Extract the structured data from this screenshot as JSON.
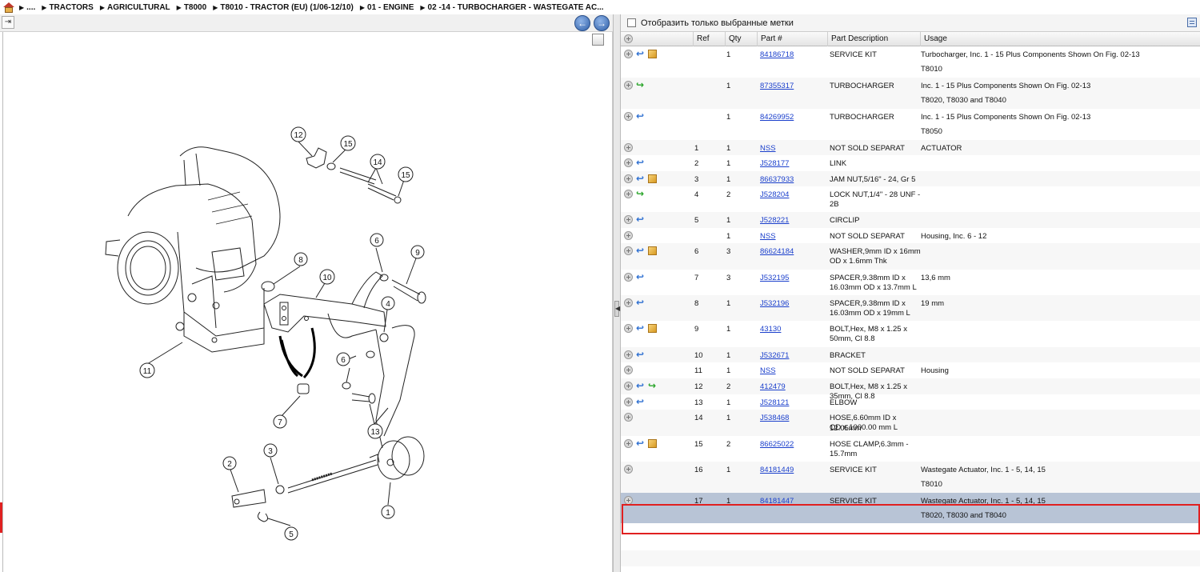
{
  "breadcrumb": {
    "items": [
      "....",
      "TRACTORS",
      "AGRICULTURAL",
      "T8000",
      "T8010 - TRACTOR (EU) (1/06-12/10)",
      "01 - ENGINE",
      "02 -14 - TURBOCHARGER - WASTEGATE AC..."
    ]
  },
  "filter": {
    "label": "Отобразить только выбранные метки"
  },
  "table": {
    "headers": {
      "ref": "Ref",
      "qty": "Qty",
      "part": "Part #",
      "desc": "Part Description",
      "usage": "Usage"
    },
    "rows": [
      {
        "ref": "",
        "qty": "1",
        "part": "84186718",
        "desc": "SERVICE KIT",
        "usage": "Turbocharger, Inc. 1 - 15 Plus Components Shown On Fig. 02-13",
        "usage2": "T8010",
        "icons": [
          "plus",
          "blue",
          "box"
        ]
      },
      {
        "ref": "",
        "qty": "1",
        "part": "87355317",
        "desc": "TURBOCHARGER",
        "usage": "Inc. 1 - 15 Plus Components Shown On Fig. 02-13",
        "usage2": "T8020, T8030 and T8040",
        "icons": [
          "plus",
          "green"
        ]
      },
      {
        "ref": "",
        "qty": "1",
        "part": "84269952",
        "desc": "TURBOCHARGER",
        "usage": "Inc. 1 - 15 Plus Components Shown On Fig. 02-13",
        "usage2": "T8050",
        "icons": [
          "plus",
          "blue"
        ]
      },
      {
        "ref": "1",
        "qty": "1",
        "part": "NSS",
        "desc": "NOT SOLD SEPARAT",
        "usage": "ACTUATOR",
        "usage2": "",
        "icons": [
          "plus"
        ]
      },
      {
        "ref": "2",
        "qty": "1",
        "part": "J528177",
        "desc": "LINK",
        "usage": "",
        "usage2": "",
        "icons": [
          "plus",
          "blue"
        ]
      },
      {
        "ref": "3",
        "qty": "1",
        "part": "86637933",
        "desc": "JAM NUT,5/16\" - 24, Gr 5",
        "usage": "",
        "usage2": "",
        "icons": [
          "plus",
          "blue",
          "box"
        ]
      },
      {
        "ref": "4",
        "qty": "2",
        "part": "J528204",
        "desc": "LOCK NUT,1/4\" - 28 UNF -",
        "desc2": "2B",
        "usage": "",
        "usage2": "",
        "icons": [
          "plus",
          "green"
        ]
      },
      {
        "ref": "5",
        "qty": "1",
        "part": "J528221",
        "desc": "CIRCLIP",
        "usage": "",
        "usage2": "",
        "icons": [
          "plus",
          "blue"
        ]
      },
      {
        "ref": "",
        "qty": "1",
        "part": "NSS",
        "desc": "NOT SOLD SEPARAT",
        "usage": "Housing, Inc. 6 - 12",
        "usage2": "",
        "icons": [
          "plus"
        ]
      },
      {
        "ref": "6",
        "qty": "3",
        "part": "86624184",
        "desc": "WASHER,9mm ID x 16mm",
        "desc2": "OD x 1.6mm Thk",
        "usage": "",
        "usage2": "",
        "icons": [
          "plus",
          "blue",
          "box"
        ]
      },
      {
        "ref": "7",
        "qty": "3",
        "part": "J532195",
        "desc": "SPACER,9.38mm ID x",
        "desc2": "16.03mm OD x 13.7mm L",
        "usage": "13,6 mm",
        "usage2": "",
        "icons": [
          "plus",
          "blue"
        ]
      },
      {
        "ref": "8",
        "qty": "1",
        "part": "J532196",
        "desc": "SPACER,9.38mm ID x",
        "desc2": "16.03mm OD x 19mm L",
        "usage": "19 mm",
        "usage2": "",
        "icons": [
          "plus",
          "blue"
        ]
      },
      {
        "ref": "9",
        "qty": "1",
        "part": "43130",
        "desc": "BOLT,Hex, M8 x 1.25 x",
        "desc2": "50mm, Cl 8.8",
        "usage": "",
        "usage2": "",
        "icons": [
          "plus",
          "blue",
          "box"
        ]
      },
      {
        "ref": "10",
        "qty": "1",
        "part": "J532671",
        "desc": "BRACKET",
        "usage": "",
        "usage2": "",
        "icons": [
          "plus",
          "blue"
        ]
      },
      {
        "ref": "11",
        "qty": "1",
        "part": "NSS",
        "desc": "NOT SOLD SEPARAT",
        "usage": "Housing",
        "usage2": "",
        "icons": [
          "plus"
        ]
      },
      {
        "ref": "12",
        "qty": "2",
        "part": "412479",
        "desc": "BOLT,Hex, M8 x 1.25 x",
        "desc2": "35mm, Cl 8.8",
        "usage": "",
        "usage2": "",
        "icons": [
          "plus",
          "blue",
          "green"
        ]
      },
      {
        "ref": "13",
        "qty": "1",
        "part": "J528121",
        "desc": "ELBOW",
        "usage": "",
        "usage2": "",
        "icons": [
          "plus",
          "blue"
        ]
      },
      {
        "ref": "14",
        "qty": "1",
        "part": "J538468",
        "desc": "HOSE,6.60mm ID x 12.05mm",
        "desc2": "OD x 1000.00 mm L",
        "usage": "",
        "usage2": "",
        "icons": [
          "plus"
        ]
      },
      {
        "ref": "15",
        "qty": "2",
        "part": "86625022",
        "desc": "HOSE CLAMP,6.3mm -",
        "desc2": "15.7mm",
        "usage": "",
        "usage2": "",
        "icons": [
          "plus",
          "blue",
          "box"
        ]
      },
      {
        "ref": "16",
        "qty": "1",
        "part": "84181449",
        "desc": "SERVICE KIT",
        "usage": "Wastegate Actuator, Inc. 1 - 5, 14, 15",
        "usage2": "T8010",
        "icons": [
          "plus"
        ]
      },
      {
        "ref": "17",
        "qty": "1",
        "part": "84181447",
        "desc": "SERVICE KIT",
        "usage": "Wastegate Actuator, Inc. 1 - 5, 14, 15",
        "usage2": "T8020, T8030 and T8040",
        "icons": [
          "plus"
        ],
        "selected": true
      }
    ]
  },
  "diagram": {
    "callouts": [
      "1",
      "2",
      "3",
      "4",
      "5",
      "6",
      "6",
      "7",
      "8",
      "9",
      "10",
      "11",
      "12",
      "13",
      "14",
      "15",
      "15"
    ]
  }
}
